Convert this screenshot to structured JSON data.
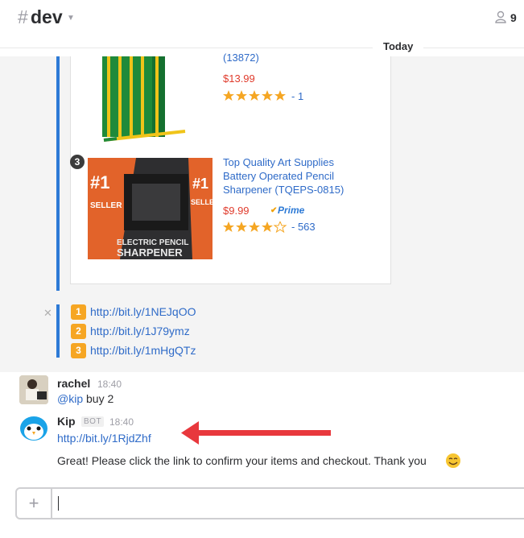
{
  "channel": {
    "hash": "#",
    "name": "dev"
  },
  "members": {
    "count": "9"
  },
  "day_divider": "Today",
  "product1": {
    "title_fragment": "(13872)",
    "price": "$13.99",
    "rating": 5,
    "review_count": "- 1"
  },
  "product3": {
    "badge": "3",
    "title": "Top Quality Art Supplies Battery Operated Pencil Sharpener (TQEPS-0815)",
    "price": "$9.99",
    "prime": "Prime",
    "rating": 4,
    "review_count": "- 563"
  },
  "links": [
    {
      "badge": "1",
      "url": "http://bit.ly/1NEJqOO"
    },
    {
      "badge": "2",
      "url": "http://bit.ly/1J79ymz"
    },
    {
      "badge": "3",
      "url": "http://bit.ly/1mHgQTz"
    }
  ],
  "messages": [
    {
      "author": "rachel",
      "time": "18:40",
      "mention": "@kip",
      "text": " buy 2"
    },
    {
      "author": "Kip",
      "tag": "BOT",
      "time": "18:40",
      "link": "http://bit.ly/1RjdZhf",
      "text": "Great! Please click the link to confirm your items and checkout. Thank you"
    }
  ],
  "colors": {
    "link": "#2f6bc8",
    "price": "#e03b2c",
    "attachment_bar": "#2d7ad6",
    "arrow": "#e8383d",
    "keycap": "#f6a623"
  }
}
